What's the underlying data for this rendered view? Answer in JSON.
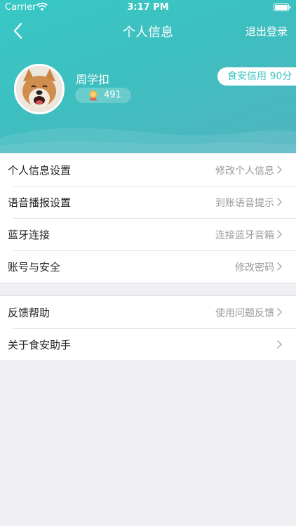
{
  "status_bar": {
    "carrier": "Carrier",
    "time": "3:17 PM"
  },
  "nav": {
    "title": "个人信息",
    "logout": "退出登录"
  },
  "profile": {
    "name": "周学扣",
    "points": "491",
    "credit": "食安信用 90分"
  },
  "colors": {
    "accent": "#3ec3c2",
    "header_start": "#37c9c6",
    "header_end": "#4fb4bf",
    "background": "#efeff4"
  },
  "settings_group_1": [
    {
      "label": "个人信息设置",
      "detail": "修改个人信息"
    },
    {
      "label": "语音播报设置",
      "detail": "到账语音提示"
    },
    {
      "label": "蓝牙连接",
      "detail": "连接蓝牙音箱"
    },
    {
      "label": "账号与安全",
      "detail": "修改密码"
    }
  ],
  "settings_group_2": [
    {
      "label": "反馈帮助",
      "detail": "使用问题反馈"
    },
    {
      "label": "关于食安助手",
      "detail": ""
    }
  ]
}
